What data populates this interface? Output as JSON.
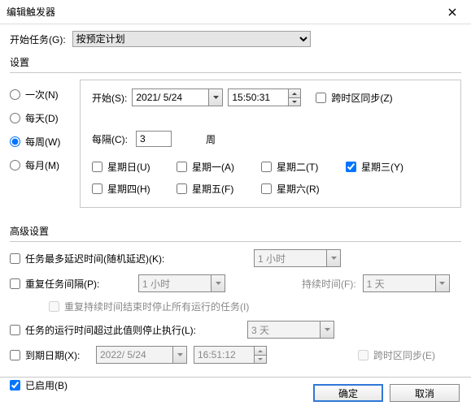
{
  "title": "编辑触发器",
  "begin_task": {
    "label": "开始任务(G):",
    "value": "按预定计划"
  },
  "settings": {
    "label": "设置",
    "radios": {
      "once": "一次(N)",
      "daily": "每天(D)",
      "weekly": "每周(W)",
      "monthly": "每月(M)",
      "selected": "weekly"
    },
    "start": {
      "label": "开始(S):",
      "date": "2021/ 5/24",
      "time": "15:50:31"
    },
    "tz_sync": {
      "label": "跨时区同步(Z)",
      "checked": false
    },
    "recur": {
      "label": "每隔(C):",
      "value": "3",
      "unit": "周"
    },
    "days": {
      "sun": {
        "label": "星期日(U)",
        "checked": false
      },
      "mon": {
        "label": "星期一(A)",
        "checked": false
      },
      "tue": {
        "label": "星期二(T)",
        "checked": false
      },
      "wed": {
        "label": "星期三(Y)",
        "checked": true
      },
      "thu": {
        "label": "星期四(H)",
        "checked": false
      },
      "fri": {
        "label": "星期五(F)",
        "checked": false
      },
      "sat": {
        "label": "星期六(R)",
        "checked": false
      }
    }
  },
  "advanced": {
    "label": "高级设置",
    "delay": {
      "label": "任务最多延迟时间(随机延迟)(K):",
      "checked": false,
      "value": "1 小时"
    },
    "repeat": {
      "label": "重复任务间隔(P):",
      "checked": false,
      "value": "1 小时",
      "duration_label": "持续时间(F):",
      "duration_value": "1 天"
    },
    "stop_at_end": {
      "label": "重复持续时间结束时停止所有运行的任务(I)",
      "checked": false
    },
    "stop_if": {
      "label": "任务的运行时间超过此值则停止执行(L):",
      "checked": false,
      "value": "3 天"
    },
    "expire": {
      "label": "到期日期(X):",
      "checked": false,
      "date": "2022/ 5/24",
      "time": "16:51:12",
      "tz_label": "跨时区同步(E)"
    },
    "enabled": {
      "label": "已启用(B)",
      "checked": true
    }
  },
  "buttons": {
    "ok": "确定",
    "cancel": "取消"
  }
}
